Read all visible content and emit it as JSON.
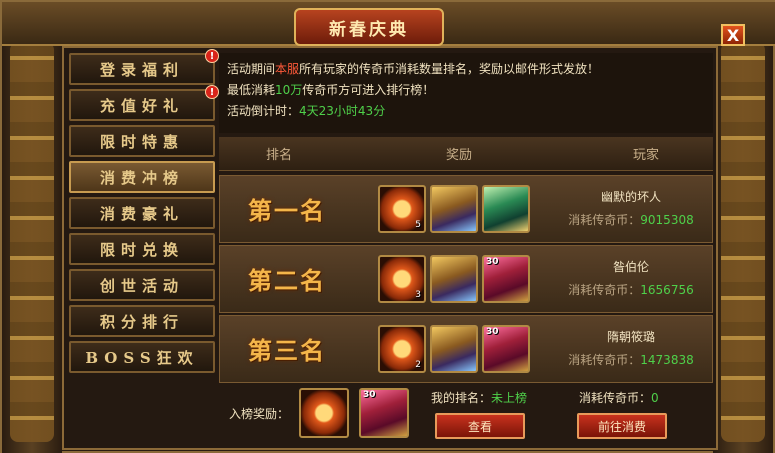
{
  "window": {
    "title": "新春庆典",
    "close_label": "X"
  },
  "sidebar": {
    "items": [
      {
        "label": "登录福利",
        "badge": "!"
      },
      {
        "label": "充值好礼",
        "badge": "!"
      },
      {
        "label": "限时特惠"
      },
      {
        "label": "消费冲榜",
        "active": true
      },
      {
        "label": "消费豪礼"
      },
      {
        "label": "限时兑换"
      },
      {
        "label": "创世活动"
      },
      {
        "label": "积分排行"
      },
      {
        "label": "BOSS狂欢"
      }
    ]
  },
  "info": {
    "line1_a": "活动期间",
    "line1_b": "本服",
    "line1_c": "所有玩家的传奇币消耗数量排名，奖励以邮件形式发放！",
    "line2_a": "最低消耗",
    "line2_b": "10万",
    "line2_c": "传奇币方可进入排行榜！",
    "line3_a": "活动倒计时：",
    "line3_b": "4天23小时43分"
  },
  "table": {
    "headers": [
      "排名",
      "奖励",
      "玩家"
    ],
    "cost_label": "消耗传奇币：",
    "rows": [
      {
        "rank": "第一名",
        "rewards": [
          {
            "type": "orb",
            "count": "5"
          },
          {
            "type": "chest-gold",
            "count": ""
          },
          {
            "type": "chest-green",
            "count": ""
          }
        ],
        "player": "幽默的坏人",
        "cost": "9015308"
      },
      {
        "rank": "第二名",
        "rewards": [
          {
            "type": "orb",
            "count": "3"
          },
          {
            "type": "chest-gold",
            "count": ""
          },
          {
            "type": "chest-purple",
            "count": "",
            "tag": "30"
          }
        ],
        "player": "昝伯伦",
        "cost": "1656756"
      },
      {
        "rank": "第三名",
        "rewards": [
          {
            "type": "orb",
            "count": "2"
          },
          {
            "type": "chest-gold",
            "count": ""
          },
          {
            "type": "chest-purple",
            "count": "",
            "tag": "30"
          }
        ],
        "player": "隋朝筱璐",
        "cost": "1473838"
      }
    ]
  },
  "footer": {
    "reward_label": "入榜奖励：",
    "reward_tag": "30",
    "my_rank_label": "我的排名：",
    "my_rank_value": "未上榜",
    "my_cost_label": "消耗传奇币：",
    "my_cost_value": "0",
    "view_button": "查看",
    "go_button": "前往消费"
  }
}
